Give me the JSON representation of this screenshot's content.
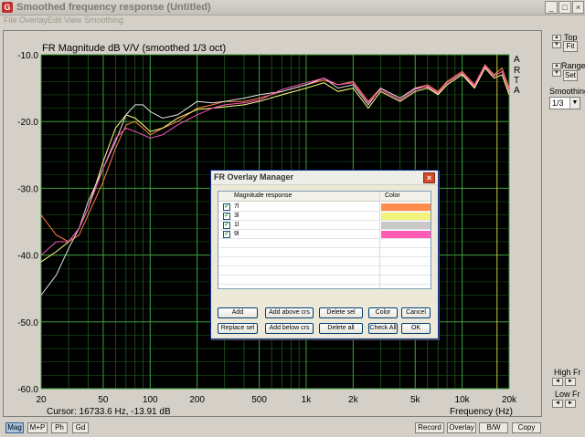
{
  "window": {
    "title": "Smoothed frequency response (Untitled)",
    "icon": "arta-app-icon",
    "controls": [
      "_",
      "□",
      "×"
    ]
  },
  "menu": [
    "File",
    "Overlay",
    "Edit",
    "View",
    "Smoothing"
  ],
  "side": {
    "top_label": "Top",
    "fit_label": "Fit",
    "range_label": "Range",
    "set_label": "Set",
    "smoothing_label": "Smoothing",
    "smoothing_value": "1/3",
    "high_fr_label": "High Fr",
    "low_fr_label": "Low Fr"
  },
  "plot": {
    "cursor_text": "Cursor: 16733.6 Hz, -13.91 dB",
    "arta_letters": [
      "A",
      "R",
      "T",
      "A"
    ]
  },
  "chart_data": {
    "type": "line",
    "title": "FR Magnitude dB V/V (smoothed 1/3 oct)",
    "xlabel": "Frequency (Hz)",
    "ylabel": "",
    "x_scale": "log",
    "xlim": [
      20,
      20000
    ],
    "ylim": [
      -60,
      -10
    ],
    "x_ticks": [
      20,
      50,
      100,
      200,
      500,
      1000,
      2000,
      5000,
      10000,
      20000
    ],
    "x_tick_labels": [
      "20",
      "50",
      "100",
      "200",
      "500",
      "1k",
      "2k",
      "5k",
      "10k",
      "20k"
    ],
    "y_ticks": [
      -10,
      -20,
      -30,
      -40,
      -50,
      -60
    ],
    "y_tick_labels": [
      "-10.0",
      "-20.0",
      "-30.0",
      "-40.0",
      "-50.0",
      "-60.0"
    ],
    "grid": true,
    "background": "#000000",
    "cursor_line_hz": 16733.6,
    "x": [
      20,
      25,
      30,
      35,
      40,
      50,
      60,
      70,
      80,
      90,
      100,
      120,
      150,
      200,
      250,
      300,
      400,
      500,
      700,
      1000,
      1300,
      1600,
      2000,
      2500,
      3000,
      4000,
      5000,
      6000,
      7000,
      8000,
      10000,
      12000,
      14000,
      16000,
      18000,
      20000
    ],
    "series": [
      {
        "name": "7l",
        "color": "#ff8040",
        "values": [
          -34,
          -37,
          -38,
          -37,
          -34,
          -29,
          -24,
          -20.5,
          -20,
          -21,
          -22,
          -21,
          -20,
          -18,
          -17.5,
          -17,
          -17,
          -16.5,
          -15.5,
          -14.5,
          -13.8,
          -14.5,
          -14,
          -17,
          -15,
          -16.5,
          -15,
          -14.5,
          -15.5,
          -14,
          -12.5,
          -14.5,
          -11.5,
          -13,
          -12,
          -15
        ]
      },
      {
        "name": "3l",
        "color": "#ffff80",
        "values": [
          -41,
          -39.5,
          -38,
          -36,
          -33,
          -26,
          -21,
          -19,
          -19.5,
          -20.5,
          -21.5,
          -21,
          -19.5,
          -18.2,
          -18,
          -17.8,
          -17.5,
          -17,
          -16,
          -15,
          -14.2,
          -15.5,
          -15,
          -18,
          -15.5,
          -17,
          -15.5,
          -15,
          -16,
          -14.5,
          -13,
          -15,
          -12,
          -13.5,
          -13,
          -16
        ]
      },
      {
        "name": "1l",
        "color": "#e0e0e0",
        "values": [
          -46,
          -43,
          -39,
          -36,
          -32,
          -27,
          -23,
          -19,
          -17.5,
          -17.5,
          -18.5,
          -19.5,
          -19,
          -17,
          -17.2,
          -17,
          -16.5,
          -16,
          -15.5,
          -14.5,
          -13.5,
          -15,
          -14.5,
          -17.5,
          -15,
          -16.5,
          -15,
          -14.8,
          -15.8,
          -14.2,
          -12.8,
          -14.8,
          -11.8,
          -13.2,
          -12.5,
          -15.5
        ]
      },
      {
        "name": "9l",
        "color": "#ff50c0",
        "values": [
          -40,
          -38,
          -38,
          -36,
          -33,
          -27,
          -22.5,
          -21,
          -21.5,
          -22,
          -22.5,
          -22,
          -20.5,
          -19,
          -18,
          -17.5,
          -17.2,
          -16.8,
          -15.2,
          -14.2,
          -13.5,
          -14.5,
          -14.2,
          -17.2,
          -15.2,
          -16.8,
          -15.2,
          -14.7,
          -15.7,
          -14.2,
          -12.7,
          -14.7,
          -11.7,
          -13.2,
          -12.5,
          -15.3
        ]
      }
    ]
  },
  "dialog": {
    "title": "FR Overlay Manager",
    "close": "×",
    "col_magnitude": "Magnitude response",
    "col_color": "Color",
    "rows": [
      {
        "name": "7l",
        "checked": true,
        "color": "#ff8c4a"
      },
      {
        "name": "3l",
        "checked": true,
        "color": "#f2f27a"
      },
      {
        "name": "1l",
        "checked": true,
        "color": "#c8c8c8"
      },
      {
        "name": "9l",
        "checked": true,
        "color": "#ff5ab4"
      }
    ],
    "buttons_row1": [
      "Add",
      "Add above crs",
      "Delete sel",
      "Color",
      "Cancel"
    ],
    "buttons_row2": [
      "Replace sel",
      "Add below crs",
      "Delete all",
      "Check All",
      "OK"
    ]
  },
  "bottom": {
    "left_buttons": [
      "Mag",
      "M+P",
      "Ph",
      "Gd"
    ],
    "right_buttons": [
      "Record",
      "Overlay",
      "B/W",
      "Copy"
    ]
  }
}
